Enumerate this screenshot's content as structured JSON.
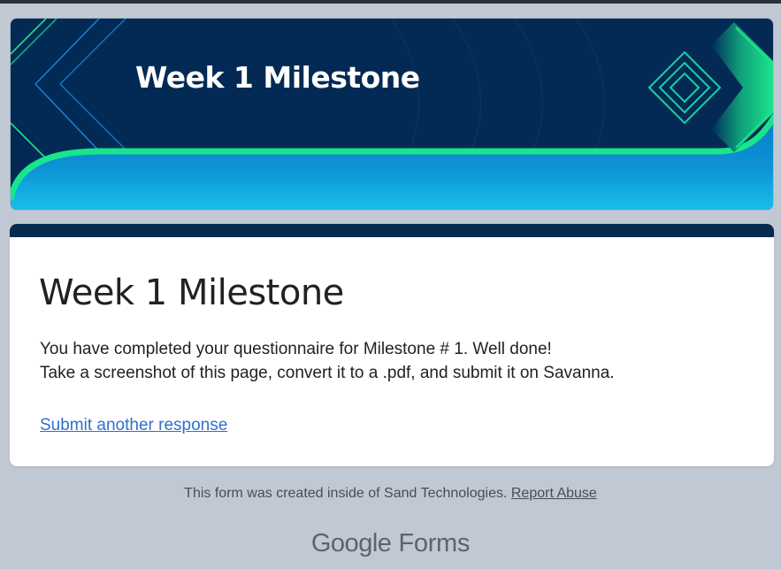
{
  "banner": {
    "title": "Week 1 Milestone",
    "colors": {
      "navy": "#022a54",
      "green": "#19e58a",
      "blue": "#0a84cc",
      "light_blue": "#14b8e8"
    }
  },
  "card": {
    "title": "Week 1 Milestone",
    "message_line_1": "You have completed your questionnaire for Milestone # 1. Well done!",
    "message_line_2": "Take a screenshot of this page, convert it to a .pdf, and submit it on Savanna.",
    "submit_another_label": "Submit another response",
    "accent_color": "#072a4f",
    "link_color": "#2f6fd0"
  },
  "footer": {
    "note": "This form was created inside of Sand Technologies.",
    "report_abuse_label": "Report Abuse",
    "brand_google": "Google",
    "brand_forms": "Forms"
  }
}
